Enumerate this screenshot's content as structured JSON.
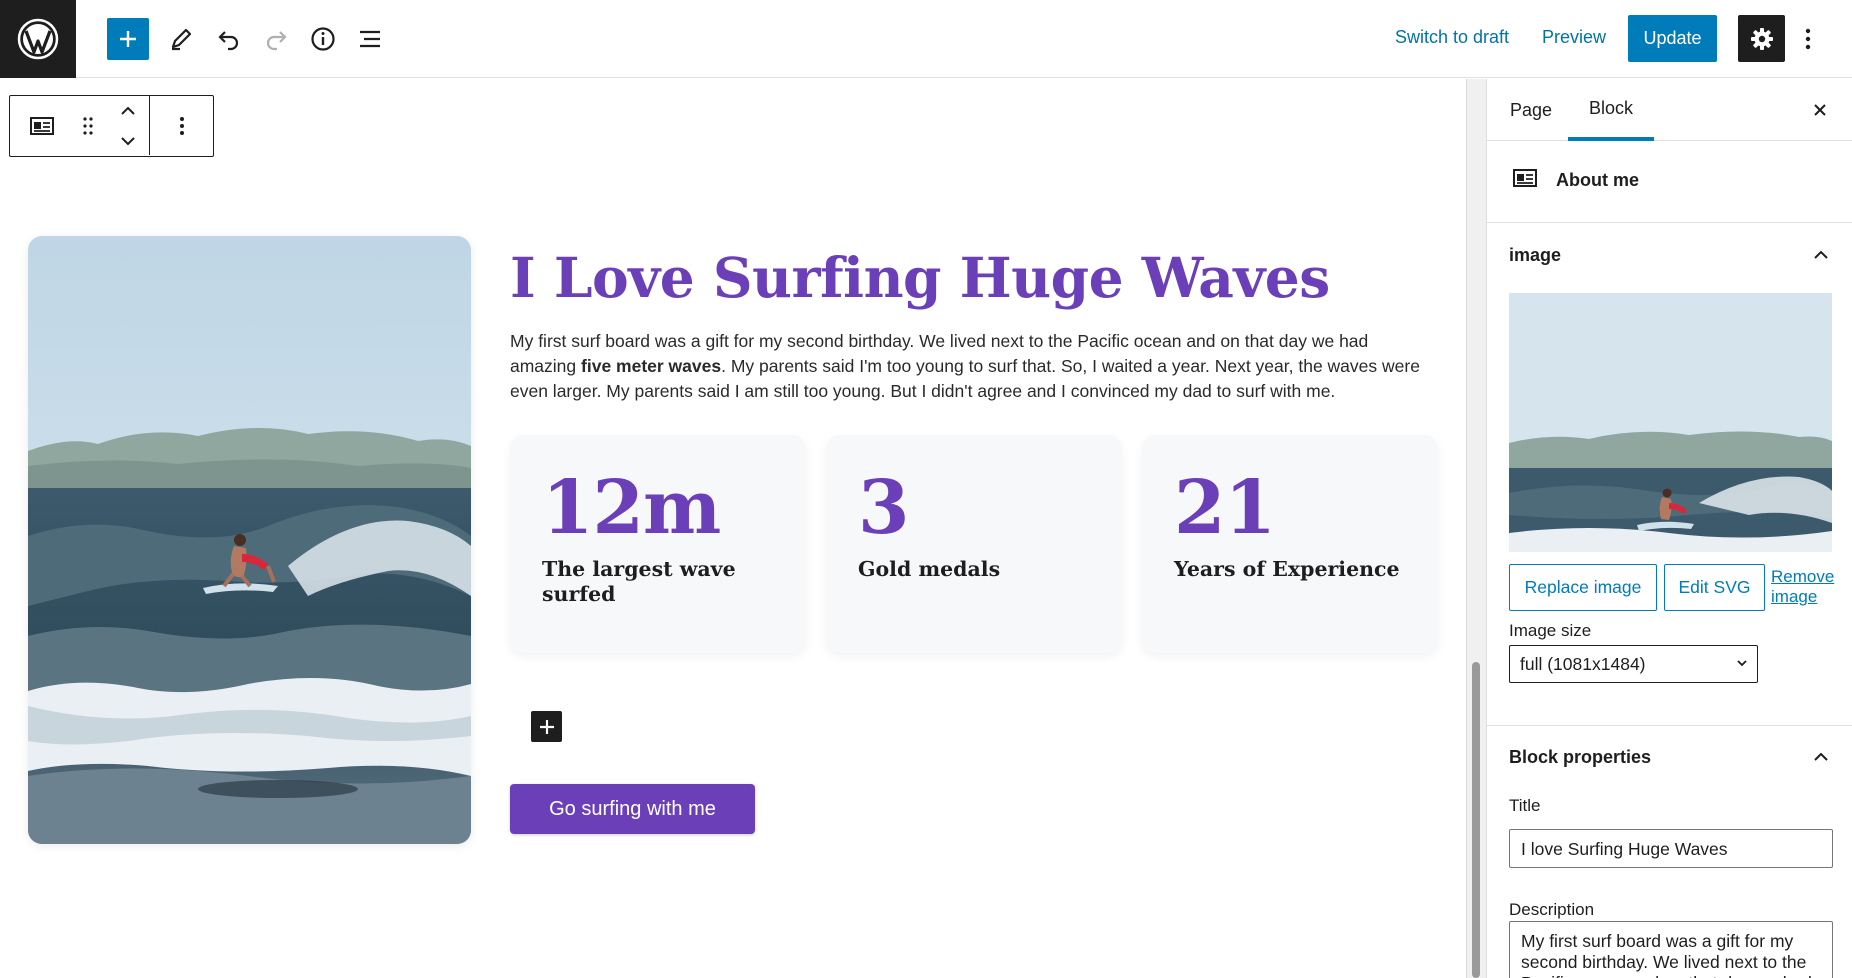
{
  "topbar": {
    "switch_to_draft": "Switch to draft",
    "preview": "Preview",
    "update": "Update",
    "icons": [
      "wordpress-logo",
      "plus-icon",
      "pencil-icon",
      "undo-icon",
      "redo-icon",
      "info-icon",
      "list-view-icon",
      "gear-icon",
      "more-vertical-icon"
    ]
  },
  "block_toolbar": {
    "icons": [
      "about-me-block-icon",
      "drag-handle-icon",
      "move-up-icon",
      "move-down-icon",
      "more-vertical-icon"
    ]
  },
  "content": {
    "heading": "I Love Surfing Huge Waves",
    "paragraph_before": "My first surf board was a gift for my second birthday. We lived next to the Pacific ocean and on that day we had amazing ",
    "paragraph_bold": "five meter waves",
    "paragraph_after": ". My parents said I'm too young to surf that. So, I waited a year. Next year, the waves were even larger. My parents said I am still too young. But I didn't agree and I convinced my dad to surf with me.",
    "stats": [
      {
        "number": "12m",
        "label": "The largest wave surfed"
      },
      {
        "number": "3",
        "label": "Gold medals"
      },
      {
        "number": "21",
        "label": "Years of Experience"
      }
    ],
    "cta": "Go surfing with me"
  },
  "sidebar": {
    "tabs": [
      "Page",
      "Block"
    ],
    "active_tab": "Block",
    "block_name": "About me",
    "image_panel": {
      "title": "image",
      "replace": "Replace image",
      "edit_svg": "Edit SVG",
      "remove": "Remove image",
      "size_label": "Image size",
      "size_value": "full (1081x1484)"
    },
    "properties_panel": {
      "title": "Block properties",
      "title_label": "Title",
      "title_value": "I love Surfing Huge Waves",
      "description_label": "Description",
      "description_value": "My first surf board was a gift for my second birthday. We lived next to the Pacific ocean and on that day we had amazing five meter waves."
    }
  },
  "colors": {
    "accent": "#007cba",
    "purple": "#6b3fb8",
    "dark": "#1e1e1e"
  }
}
